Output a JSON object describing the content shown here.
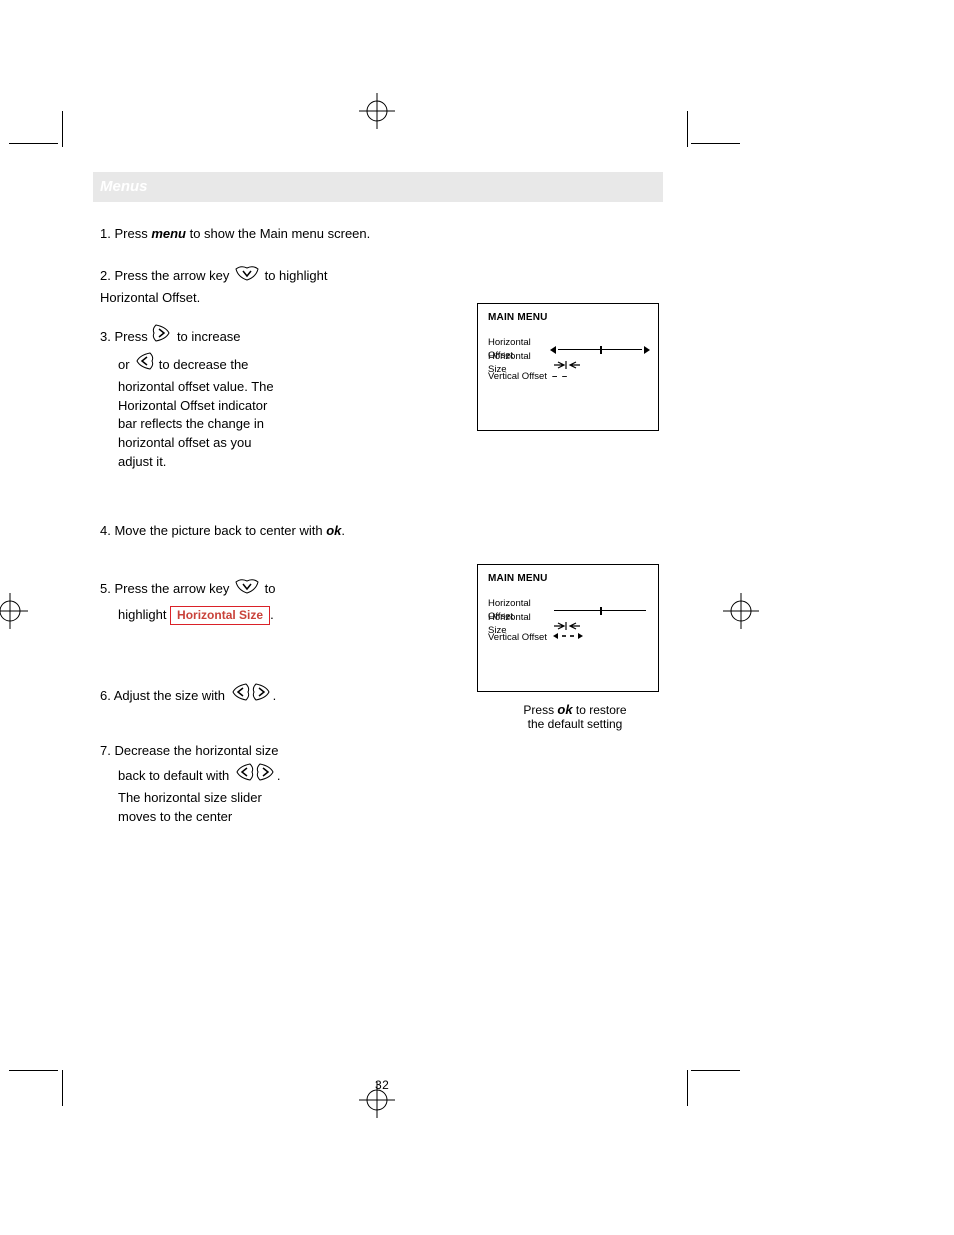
{
  "header_bar": "Menus",
  "step1": {
    "num": "1.",
    "pre": "Press ",
    "key": "menu",
    "post": " to show the Main menu screen."
  },
  "step2": {
    "num": "2.",
    "pre": "Press the arrow key ",
    "post": " to highlight Horizontal Offset."
  },
  "step3": {
    "num": "3.",
    "line1_pre": "Press ",
    "line1_post": " to increase",
    "line2_pre": "or ",
    "line2_post": " to decrease the",
    "line3": "horizontal offset value. The",
    "line4": "Horizontal Offset indicator",
    "line5": "bar reflects the change in",
    "line6": "horizontal offset as you",
    "line7": "adjust it."
  },
  "step4": {
    "num": "4.",
    "pre": "Move the picture back to center with ",
    "key": "ok",
    "post": "."
  },
  "step5": {
    "num": "5.",
    "pre": "Press the arrow key ",
    "post_a": " to",
    "line2_pre": "highlight ",
    "line2_hl": "Horizontal Size",
    "line2_post": "."
  },
  "step6": {
    "num": "6.",
    "pre": "Adjust the size with ",
    "post": "."
  },
  "step7": {
    "num": "7.",
    "line1": "Decrease the horizontal size",
    "line2_pre": "back to default with ",
    "line2_post": ".",
    "line3": "The horizontal size slider",
    "line4": "moves to the center"
  },
  "screen1": {
    "title": "MAIN MENU",
    "row1": "Horizontal Offset",
    "row2": "Horizontal Size",
    "row3": "Vertical Offset"
  },
  "screen2": {
    "title": "MAIN MENU",
    "row1": "Horizontal Offset",
    "row2": "Horizontal Size",
    "row3": "Vertical Offset"
  },
  "caption": {
    "line1_pre": "Press ",
    "line1_key": "ok",
    "line1_post": " to restore",
    "line2": "the default setting"
  },
  "pagenum": "32"
}
